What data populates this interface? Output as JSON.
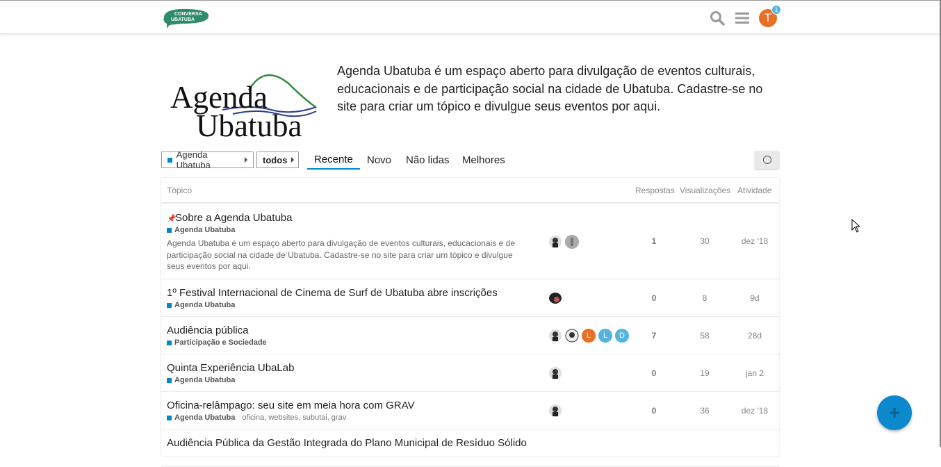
{
  "header": {
    "logo_text_top": "CONVERSA",
    "logo_text_bottom": "UBATUBA",
    "user_initial": "T",
    "notification_count": "1",
    "icons": [
      "search-icon",
      "hamburger-menu-icon"
    ]
  },
  "hero": {
    "logo_line1": "Agenda",
    "logo_line2": "Ubatuba",
    "description": "Agenda Ubatuba é um espaço aberto para divulgação de eventos culturais, educacionais e de participação social na cidade de Ubatuba. Cadastre-se no site para criar um tópico e divulgue seus eventos por aqui."
  },
  "nav": {
    "category_dropdown": "Agenda Ubatuba",
    "subcategory_dropdown": "todos",
    "tabs": [
      "Recente",
      "Novo",
      "Não lidas",
      "Melhores"
    ],
    "active_tab": "Recente"
  },
  "table": {
    "headers": {
      "topic": "Tópico",
      "replies": "Respostas",
      "views": "Visualizações",
      "activity": "Atividade"
    },
    "rows": [
      {
        "title": "Sobre a Agenda Ubatuba",
        "pinned": true,
        "category": "Agenda Ubatuba",
        "excerpt": "Agenda Ubatuba é um espaço aberto para divulgação de eventos culturais, educacionais e de participação social na cidade de Ubatuba. Cadastre-se no site para criar um tópico e divulgue seus eventos por aqui.",
        "replies": "1",
        "views": "30",
        "activity": "dez '18"
      },
      {
        "title": "1º Festival Internacional de Cinema de Surf de Ubatuba abre inscrições",
        "category": "Agenda Ubatuba",
        "replies": "0",
        "views": "8",
        "activity": "9d"
      },
      {
        "title": "Audiência pública",
        "category": "Participação e Sociedade",
        "posters": [
          "L",
          "L",
          "D"
        ],
        "replies": "7",
        "views": "58",
        "activity": "28d"
      },
      {
        "title": "Quinta Experiência UbaLab",
        "category": "Agenda Ubatuba",
        "replies": "0",
        "views": "19",
        "activity": "jan 2"
      },
      {
        "title": "Oficina-relâmpago: seu site em meia hora com GRAV",
        "category": "Agenda Ubatuba",
        "tags": "oficina, websites, subutai, grav",
        "replies": "0",
        "views": "36",
        "activity": "dez '18"
      },
      {
        "title": "Audiência Pública da Gestão Integrada do Plano Municipal de Resíduo Sólido"
      }
    ]
  },
  "colors": {
    "accent": "#0088cc",
    "avatar_orange": "#e96f24",
    "avatar_blue": "#55b3e0",
    "fab": "#0c88cc"
  }
}
